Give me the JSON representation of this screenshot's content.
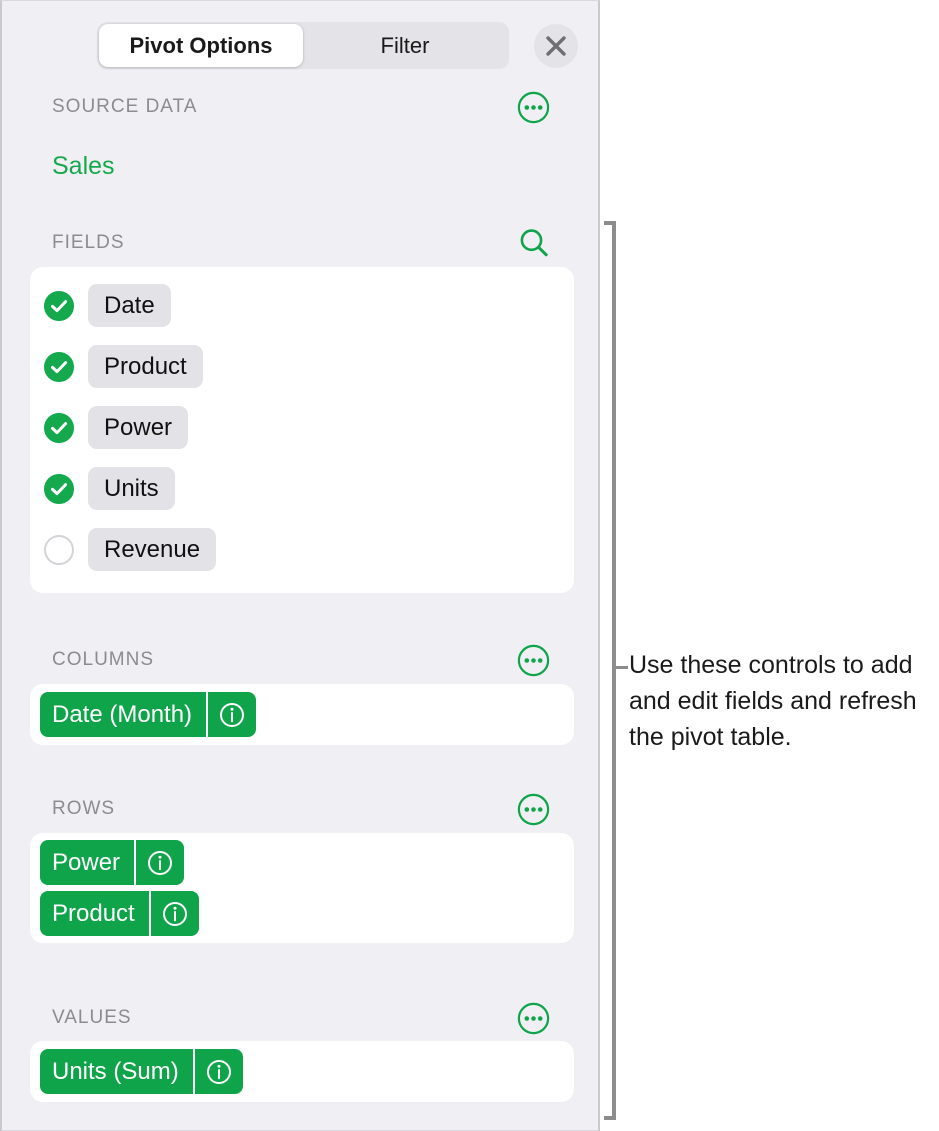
{
  "colors": {
    "accent_green": "#0FA34A",
    "check_green": "#13A94C",
    "source_link_green": "#17A84C",
    "panel_bg": "#F0F0F4",
    "card_bg": "#FFFFFF",
    "pill_bg": "#E2E2E7",
    "section_label": "#8B8B92",
    "callout_line": "#8C8C8C"
  },
  "tabs": {
    "items": [
      {
        "label": "Pivot Options",
        "active": true
      },
      {
        "label": "Filter",
        "active": false
      }
    ],
    "close_icon": "close-icon"
  },
  "sections": {
    "source_data": {
      "title": "SOURCE DATA",
      "more_icon": "more-options-icon",
      "value": "Sales"
    },
    "fields": {
      "title": "FIELDS",
      "search_icon": "search-icon",
      "items": [
        {
          "label": "Date",
          "checked": true
        },
        {
          "label": "Product",
          "checked": true
        },
        {
          "label": "Power",
          "checked": true
        },
        {
          "label": "Units",
          "checked": true
        },
        {
          "label": "Revenue",
          "checked": false
        }
      ]
    },
    "columns": {
      "title": "COLUMNS",
      "more_icon": "more-options-icon",
      "tokens": [
        {
          "label": "Date (Month)",
          "info_icon": "info-icon"
        }
      ]
    },
    "rows": {
      "title": "ROWS",
      "more_icon": "more-options-icon",
      "tokens": [
        {
          "label": "Power",
          "info_icon": "info-icon"
        },
        {
          "label": "Product",
          "info_icon": "info-icon"
        }
      ]
    },
    "values": {
      "title": "VALUES",
      "more_icon": "more-options-icon",
      "tokens": [
        {
          "label": "Units (Sum)",
          "info_icon": "info-icon"
        }
      ]
    }
  },
  "callout": {
    "text": "Use these controls to add and edit fields and refresh the pivot table."
  }
}
